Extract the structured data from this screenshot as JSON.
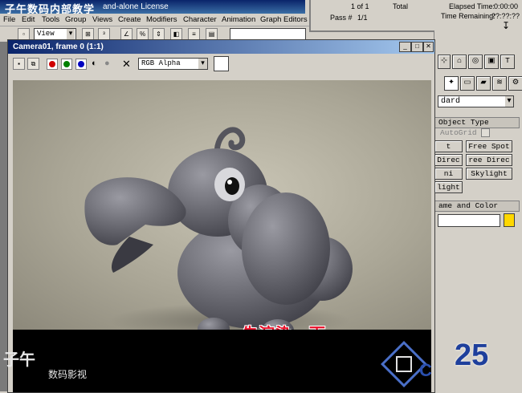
{
  "main_window": {
    "watermark_title": "子午数码内部教学",
    "license_text": "and-alone License",
    "menu": [
      "File",
      "Edit",
      "Tools",
      "Group",
      "Views",
      "Create",
      "Modifiers",
      "Character",
      "Animation",
      "Graph Editors"
    ],
    "view_dropdown": "View"
  },
  "render_progress": {
    "frame_count": "1 of 1",
    "total_label": "Total",
    "elapsed_label": "Elapsed Time:",
    "elapsed_value": "0:00:00",
    "pass_label": "Pass #",
    "pass_value": "1/1",
    "remaining_label": "Time Remaining:",
    "remaining_value": "??:??:??"
  },
  "command_panel": {
    "category_dropdown": "dard",
    "object_type_header": "Object Type",
    "autogrid_label": "AutoGrid",
    "buttons": [
      "t Spot",
      "Free Spot",
      "Direc",
      "ree Direc",
      "ni",
      "Skylight",
      "light"
    ],
    "name_color_header": "ame and Color",
    "accent_color": "#ffd700"
  },
  "render_window": {
    "title": "Camera01, frame 0 (1:1)",
    "channel_dropdown": "RGB Alpha",
    "subtitle": "先渲染一下"
  },
  "watermarks": {
    "left_big": "子午",
    "left_small": "数码影视",
    "number": "25"
  }
}
